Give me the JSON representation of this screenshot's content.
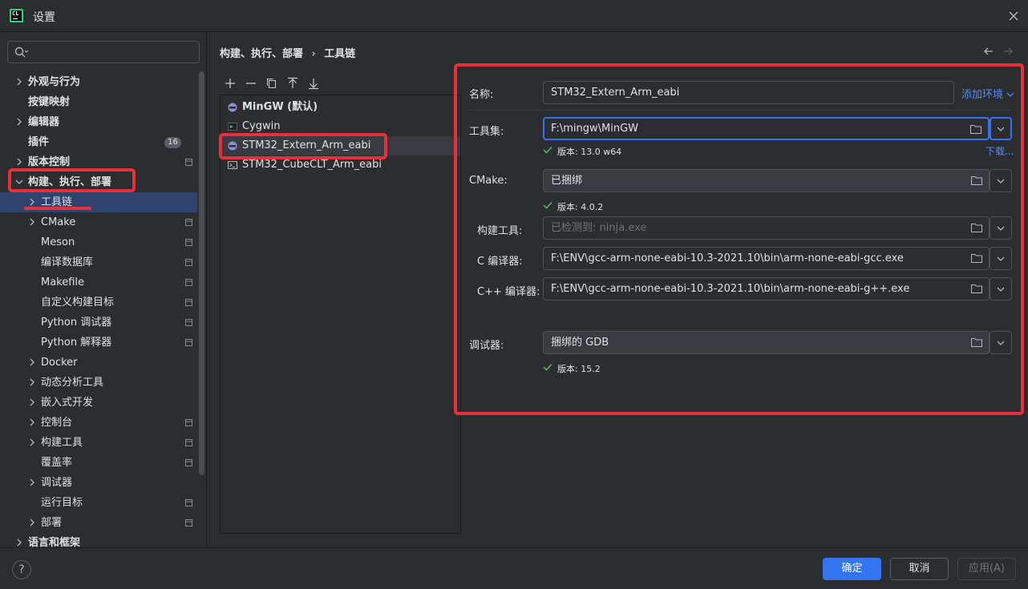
{
  "window": {
    "title": "设置",
    "app_icon": "CL"
  },
  "search": {
    "placeholder": ""
  },
  "sidebar": {
    "items": [
      {
        "label": "外观与行为",
        "expandable": true,
        "expanded": false,
        "bold": true,
        "indent": 0
      },
      {
        "label": "按键映射",
        "expandable": false,
        "bold": true,
        "indent": 0
      },
      {
        "label": "编辑器",
        "expandable": true,
        "expanded": false,
        "bold": true,
        "indent": 0
      },
      {
        "label": "插件",
        "expandable": false,
        "bold": true,
        "indent": 0,
        "badge": "16"
      },
      {
        "label": "版本控制",
        "expandable": true,
        "expanded": false,
        "bold": true,
        "indent": 0,
        "project_icon": true
      },
      {
        "label": "构建、执行、部署",
        "expandable": true,
        "expanded": true,
        "bold": true,
        "indent": 0
      },
      {
        "label": "工具链",
        "expandable": true,
        "expanded": false,
        "indent": 1,
        "selected": true
      },
      {
        "label": "CMake",
        "expandable": true,
        "expanded": false,
        "indent": 1,
        "project_icon": true
      },
      {
        "label": "Meson",
        "expandable": false,
        "indent": 1,
        "project_icon": true
      },
      {
        "label": "编译数据库",
        "expandable": false,
        "indent": 1,
        "project_icon": true
      },
      {
        "label": "Makefile",
        "expandable": false,
        "indent": 1,
        "project_icon": true
      },
      {
        "label": "自定义构建目标",
        "expandable": false,
        "indent": 1,
        "project_icon": true
      },
      {
        "label": "Python 调试器",
        "expandable": false,
        "indent": 1,
        "project_icon": true
      },
      {
        "label": "Python 解释器",
        "expandable": false,
        "indent": 1,
        "project_icon": true
      },
      {
        "label": "Docker",
        "expandable": true,
        "expanded": false,
        "indent": 1
      },
      {
        "label": "动态分析工具",
        "expandable": true,
        "expanded": false,
        "indent": 1
      },
      {
        "label": "嵌入式开发",
        "expandable": true,
        "expanded": false,
        "indent": 1
      },
      {
        "label": "控制台",
        "expandable": true,
        "expanded": false,
        "indent": 1,
        "project_icon": true
      },
      {
        "label": "构建工具",
        "expandable": true,
        "expanded": false,
        "indent": 1,
        "project_icon": true
      },
      {
        "label": "覆盖率",
        "expandable": false,
        "indent": 1,
        "project_icon": true
      },
      {
        "label": "调试器",
        "expandable": true,
        "expanded": false,
        "indent": 1
      },
      {
        "label": "运行目标",
        "expandable": false,
        "indent": 1,
        "project_icon": true
      },
      {
        "label": "部署",
        "expandable": true,
        "expanded": false,
        "indent": 1,
        "project_icon": true
      },
      {
        "label": "语言和框架",
        "expandable": true,
        "expanded": false,
        "bold": true,
        "indent": 0
      }
    ]
  },
  "breadcrumb": {
    "parent": "构建、执行、部署",
    "separator": "›",
    "current": "工具链"
  },
  "toolchain_list": {
    "toolbar": [
      "add-icon",
      "remove-icon",
      "copy-icon",
      "move-up-icon",
      "move-down-icon"
    ],
    "items": [
      {
        "label": "MinGW (默认)",
        "icon": "gnu-icon",
        "bold": true
      },
      {
        "label": "Cygwin",
        "icon": "cygwin-icon"
      },
      {
        "label": "STM32_Extern_Arm_eabi",
        "icon": "gnu-icon",
        "selected": true
      },
      {
        "label": "STM32_CubeCLT_Arm_eabi",
        "icon": "terminal-icon"
      }
    ]
  },
  "form": {
    "name_label": "名称:",
    "name_value": "STM32_Extern_Arm_eabi",
    "add_env_label": "添加环境",
    "toolset_label": "工具集:",
    "toolset_value": "F:\\mingw\\MinGW",
    "toolset_version": "版本: 13.0 w64",
    "download_label": "下载...",
    "cmake_label": "CMake:",
    "cmake_value": "已捆绑",
    "cmake_version": "版本: 4.0.2",
    "build_tool_label": "构建工具:",
    "build_tool_placeholder": "已检测到: ninja.exe",
    "c_compiler_label": "C 编译器:",
    "c_compiler_value": "F:\\ENV\\gcc-arm-none-eabi-10.3-2021.10\\bin\\arm-none-eabi-gcc.exe",
    "cpp_compiler_label": "C++ 编译器:",
    "cpp_compiler_value": "F:\\ENV\\gcc-arm-none-eabi-10.3-2021.10\\bin\\arm-none-eabi-g++.exe",
    "debugger_label": "调试器:",
    "debugger_value": "捆绑的 GDB",
    "debugger_version": "版本: 15.2"
  },
  "footer": {
    "help": "?",
    "ok": "确定",
    "cancel": "取消",
    "apply": "应用(A)"
  },
  "colors": {
    "accent": "#3574f0",
    "link": "#548af7",
    "annotation_red": "#e8303a",
    "check_green": "#5fb865",
    "selection": "#2e436e"
  }
}
